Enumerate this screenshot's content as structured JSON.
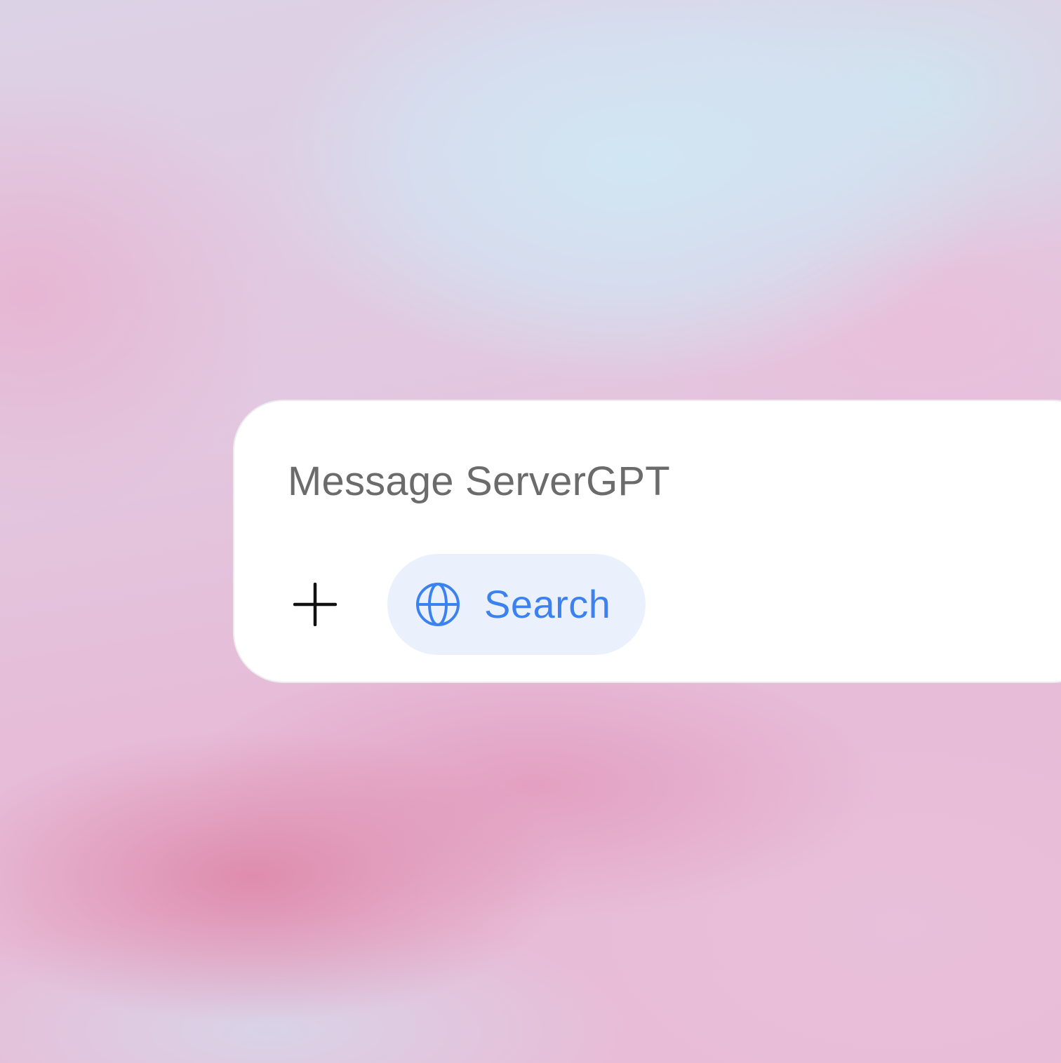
{
  "composer": {
    "placeholder": "Message ServerGPT",
    "add_icon": "plus-icon",
    "search": {
      "label": "Search",
      "icon": "globe-icon",
      "accent_color": "#3b82f0",
      "background_color": "#eaf1fd"
    }
  }
}
